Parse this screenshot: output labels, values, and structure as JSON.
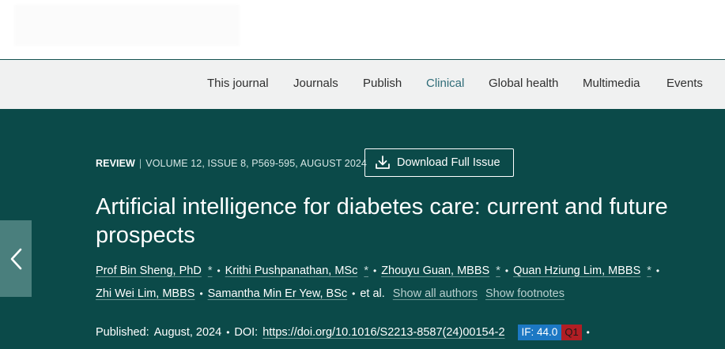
{
  "nav": {
    "items": [
      {
        "label": "This journal"
      },
      {
        "label": "Journals"
      },
      {
        "label": "Publish"
      },
      {
        "label": "Clinical"
      },
      {
        "label": "Global health"
      },
      {
        "label": "Multimedia"
      },
      {
        "label": "Events"
      }
    ],
    "active": "Clinical"
  },
  "article": {
    "type": "REVIEW",
    "separator": "|",
    "volume_info": "VOLUME 12, ISSUE 8, P569-595, AUGUST 2024",
    "download_label": "Download Full Issue",
    "title": "Artificial intelligence for diabetes care: current and future prospects",
    "authors": [
      {
        "name": "Prof Bin Sheng, PhD",
        "marker": "*"
      },
      {
        "name": "Krithi Pushpanathan, MSc",
        "marker": "*"
      },
      {
        "name": "Zhouyu Guan, MBBS",
        "marker": "*"
      },
      {
        "name": "Quan Hziung Lim, MBBS",
        "marker": "*"
      },
      {
        "name": "Zhi Wei Lim, MBBS",
        "marker": ""
      },
      {
        "name": "Samantha Min Er Yew, BSc",
        "marker": ""
      }
    ],
    "bullet": "•",
    "et_al": "et al.",
    "show_all_authors": "Show all authors",
    "show_footnotes": "Show footnotes",
    "published_label": "Published:",
    "published_date": "August, 2024",
    "doi_label": "DOI:",
    "doi": "https://doi.org/10.1016/S2213-8587(24)00154-2",
    "impact_factor": "IF: 44.0",
    "quartile": "Q1"
  },
  "colors": {
    "hero_bg": "#0b4a49",
    "nav_bg": "#f0f1f1",
    "active_nav": "#2f6c78",
    "if_badge": "#1c78c4",
    "q_badge": "#b11e24"
  },
  "icons": {
    "back": "chevron-left-icon",
    "download": "download-icon"
  }
}
